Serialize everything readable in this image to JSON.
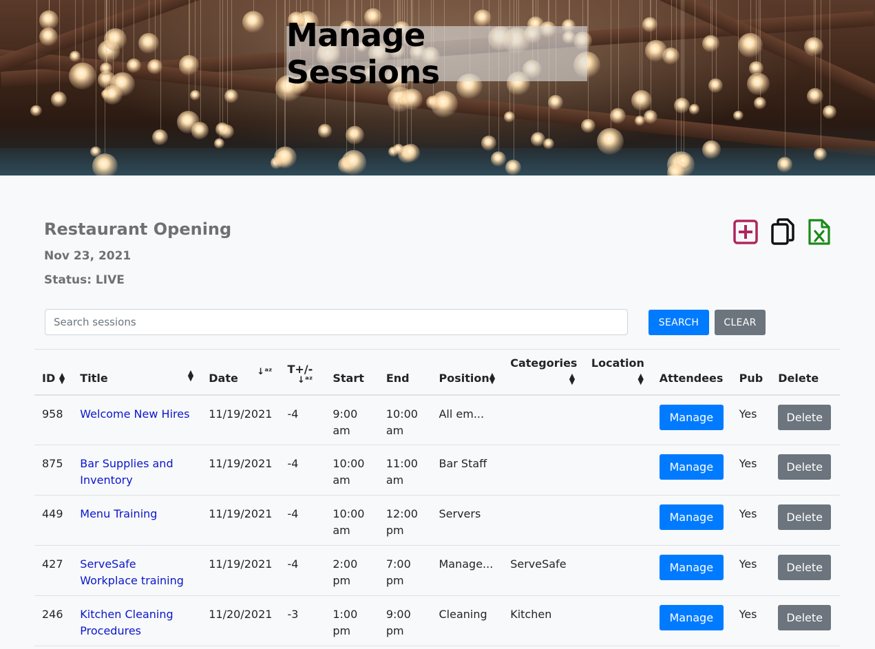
{
  "hero": {
    "title": "Manage Sessions"
  },
  "session": {
    "name": "Restaurant Opening",
    "date": "Nov 23, 2021",
    "status": "Status: LIVE"
  },
  "toolbar": {
    "add_icon": "plus-square-icon",
    "copy_icon": "copy-icon",
    "excel_icon": "excel-file-icon",
    "add_color": "#b0265c",
    "excel_color": "#1a8a1a"
  },
  "search": {
    "placeholder": "Search sessions",
    "value": "",
    "search_label": "SEARCH",
    "clear_label": "CLEAR"
  },
  "table": {
    "headers": {
      "id": "ID",
      "title": "Title",
      "date": "Date",
      "tplusminus": "T+/-",
      "start": "Start",
      "end": "End",
      "position": "Position",
      "categories": "Categories",
      "location": "Location",
      "attendees": "Attendees",
      "pub": "Pub",
      "delete": "Delete"
    },
    "rows": [
      {
        "id": "958",
        "title": "Welcome New Hires",
        "date": "11/19/2021",
        "t": "-4",
        "start": "9:00 am",
        "end": "10:00 am",
        "position": "All em...",
        "categories": "",
        "location": "",
        "manage": "Manage",
        "pub": "Yes",
        "delete": "Delete"
      },
      {
        "id": "875",
        "title": "Bar Supplies and Inventory",
        "date": "11/19/2021",
        "t": "-4",
        "start": "10:00 am",
        "end": "11:00 am",
        "position": "Bar Staff",
        "categories": "",
        "location": "",
        "manage": "Manage",
        "pub": "Yes",
        "delete": "Delete"
      },
      {
        "id": "449",
        "title": "Menu Training",
        "date": "11/19/2021",
        "t": "-4",
        "start": "10:00 am",
        "end": "12:00 pm",
        "position": "Servers",
        "categories": "",
        "location": "",
        "manage": "Manage",
        "pub": "Yes",
        "delete": "Delete"
      },
      {
        "id": "427",
        "title": "ServeSafe Workplace training",
        "date": "11/19/2021",
        "t": "-4",
        "start": "2:00 pm",
        "end": "7:00 pm",
        "position": "Manage...",
        "categories": "ServeSafe",
        "location": "",
        "manage": "Manage",
        "pub": "Yes",
        "delete": "Delete"
      },
      {
        "id": "246",
        "title": "Kitchen Cleaning Procedures",
        "date": "11/20/2021",
        "t": "-3",
        "start": "1:00 pm",
        "end": "9:00 pm",
        "position": "Cleaning",
        "categories": "Kitchen",
        "location": "",
        "manage": "Manage",
        "pub": "Yes",
        "delete": "Delete"
      }
    ]
  }
}
